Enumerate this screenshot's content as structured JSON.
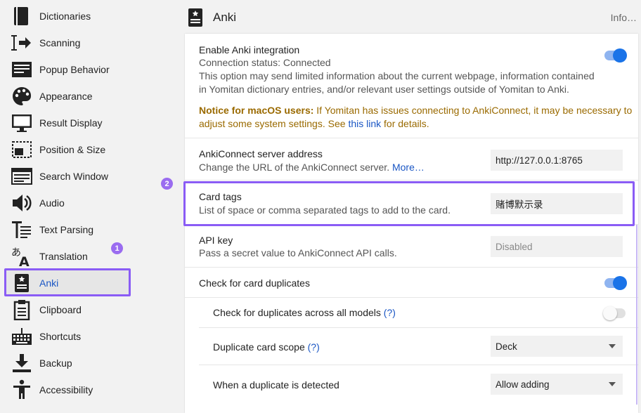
{
  "sidebar": {
    "items": [
      {
        "label": "Dictionaries",
        "icon": "book-icon"
      },
      {
        "label": "Scanning",
        "icon": "cursor-arrow-icon"
      },
      {
        "label": "Popup Behavior",
        "icon": "popup-icon"
      },
      {
        "label": "Appearance",
        "icon": "palette-icon"
      },
      {
        "label": "Result Display",
        "icon": "monitor-icon"
      },
      {
        "label": "Position & Size",
        "icon": "position-size-icon"
      },
      {
        "label": "Search Window",
        "icon": "search-window-icon"
      },
      {
        "label": "Audio",
        "icon": "speaker-icon"
      },
      {
        "label": "Text Parsing",
        "icon": "text-parsing-icon"
      },
      {
        "label": "Translation",
        "icon": "translation-icon"
      },
      {
        "label": "Anki",
        "icon": "anki-card-icon"
      },
      {
        "label": "Clipboard",
        "icon": "clipboard-icon"
      },
      {
        "label": "Shortcuts",
        "icon": "keyboard-icon"
      },
      {
        "label": "Backup",
        "icon": "download-icon"
      },
      {
        "label": "Accessibility",
        "icon": "accessibility-icon"
      }
    ],
    "active_index": 10,
    "step_badge": "1"
  },
  "header": {
    "title": "Anki",
    "info_link": "Info…"
  },
  "settings": {
    "enable": {
      "title": "Enable Anki integration",
      "status": "Connection status: Connected",
      "desc_line1": "This option may send limited information about the current webpage, information contained",
      "desc_line2": "in Yomitan dictionary entries, and/or relevant user settings outside of Yomitan to Anki.",
      "notice_bold": "Notice for macOS users:",
      "notice_text1": " If Yomitan has issues connecting to AnkiConnect, it may be necessary to",
      "notice_text2": "adjust some system settings. See ",
      "notice_link": "this link",
      "notice_text3": " for details.",
      "enabled": true
    },
    "server": {
      "title": "AnkiConnect server address",
      "desc": "Change the URL of the AnkiConnect server. ",
      "more_link": "More…",
      "value": "http://127.0.0.1:8765"
    },
    "card_tags": {
      "title": "Card tags",
      "desc": "List of space or comma separated tags to add to the card.",
      "value": "赌博默示录",
      "step_badge": "2"
    },
    "api_key": {
      "title": "API key",
      "desc": "Pass a secret value to AnkiConnect API calls.",
      "placeholder": "Disabled"
    },
    "duplicates": {
      "title": "Check for card duplicates",
      "enabled": true
    },
    "dup_all_models": {
      "title": "Check for duplicates across all models",
      "help": "(?)",
      "enabled": false
    },
    "dup_scope": {
      "title": "Duplicate card scope",
      "help": "(?)",
      "value": "Deck"
    },
    "dup_action": {
      "title": "When a duplicate is detected",
      "value": "Allow adding"
    }
  },
  "colors": {
    "accent": "#1a73e8",
    "highlight": "#8a5cf5",
    "notice": "#9a6a00",
    "link": "#1a56c4"
  }
}
